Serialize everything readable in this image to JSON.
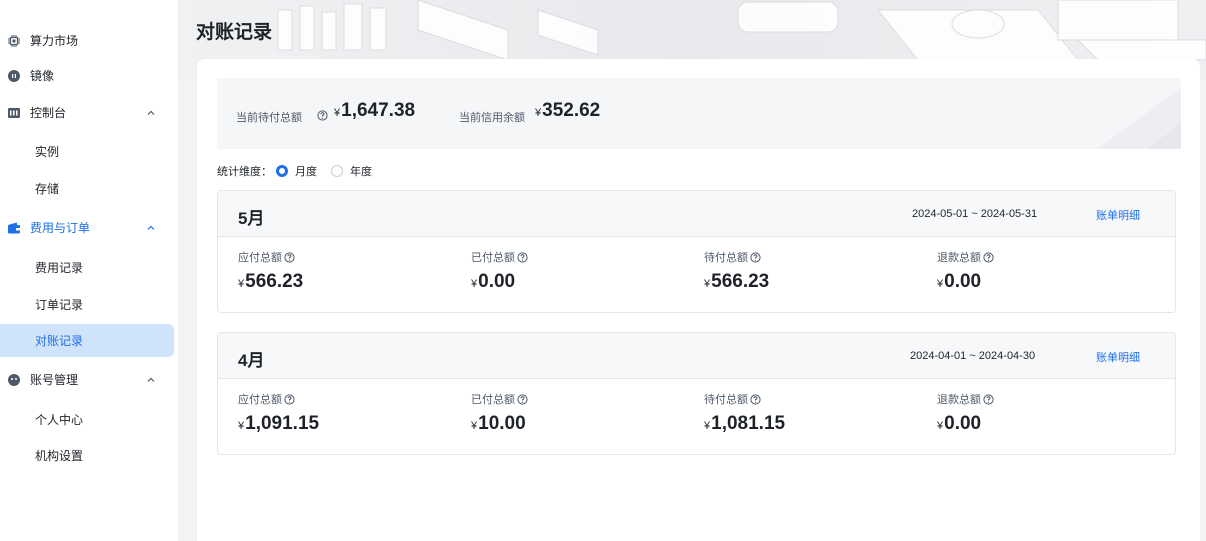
{
  "sidebar": {
    "items": [
      {
        "label": "算力市场",
        "icon": "chip-icon"
      },
      {
        "label": "镜像",
        "icon": "disc-icon"
      },
      {
        "label": "控制台",
        "icon": "console-icon",
        "expanded": true
      },
      {
        "label": "实例"
      },
      {
        "label": "存储"
      },
      {
        "label": "费用与订单",
        "icon": "wallet-icon",
        "expanded": true,
        "active": true
      },
      {
        "label": "费用记录"
      },
      {
        "label": "订单记录"
      },
      {
        "label": "对账记录",
        "selected": true
      },
      {
        "label": "账号管理",
        "icon": "user-icon",
        "expanded": true
      },
      {
        "label": "个人中心"
      },
      {
        "label": "机构设置"
      }
    ]
  },
  "page": {
    "title": "对账记录"
  },
  "summary": {
    "pending_label": "当前待付总额",
    "pending_currency": "¥",
    "pending_value": "1,647.38",
    "credit_label": "当前信用余额",
    "credit_currency": "¥",
    "credit_value": "352.62"
  },
  "dimension": {
    "label": "统计维度：",
    "options": [
      "月度",
      "年度"
    ],
    "selected": "月度"
  },
  "months": [
    {
      "title": "5月",
      "range": "2024-05-01 ~ 2024-05-31",
      "detail_label": "账单明细",
      "stats": [
        {
          "label": "应付总额",
          "currency": "¥",
          "value": "566.23"
        },
        {
          "label": "已付总额",
          "currency": "¥",
          "value": "0.00"
        },
        {
          "label": "待付总额",
          "currency": "¥",
          "value": "566.23"
        },
        {
          "label": "退款总额",
          "currency": "¥",
          "value": "0.00"
        }
      ]
    },
    {
      "title": "4月",
      "range": "2024-04-01 ~ 2024-04-30",
      "detail_label": "账单明细",
      "stats": [
        {
          "label": "应付总额",
          "currency": "¥",
          "value": "1,091.15"
        },
        {
          "label": "已付总额",
          "currency": "¥",
          "value": "10.00"
        },
        {
          "label": "待付总额",
          "currency": "¥",
          "value": "1,081.15"
        },
        {
          "label": "退款总额",
          "currency": "¥",
          "value": "0.00"
        }
      ]
    }
  ],
  "colors": {
    "accent": "#1f6fe5",
    "selected_bg": "#cfe3fb"
  }
}
